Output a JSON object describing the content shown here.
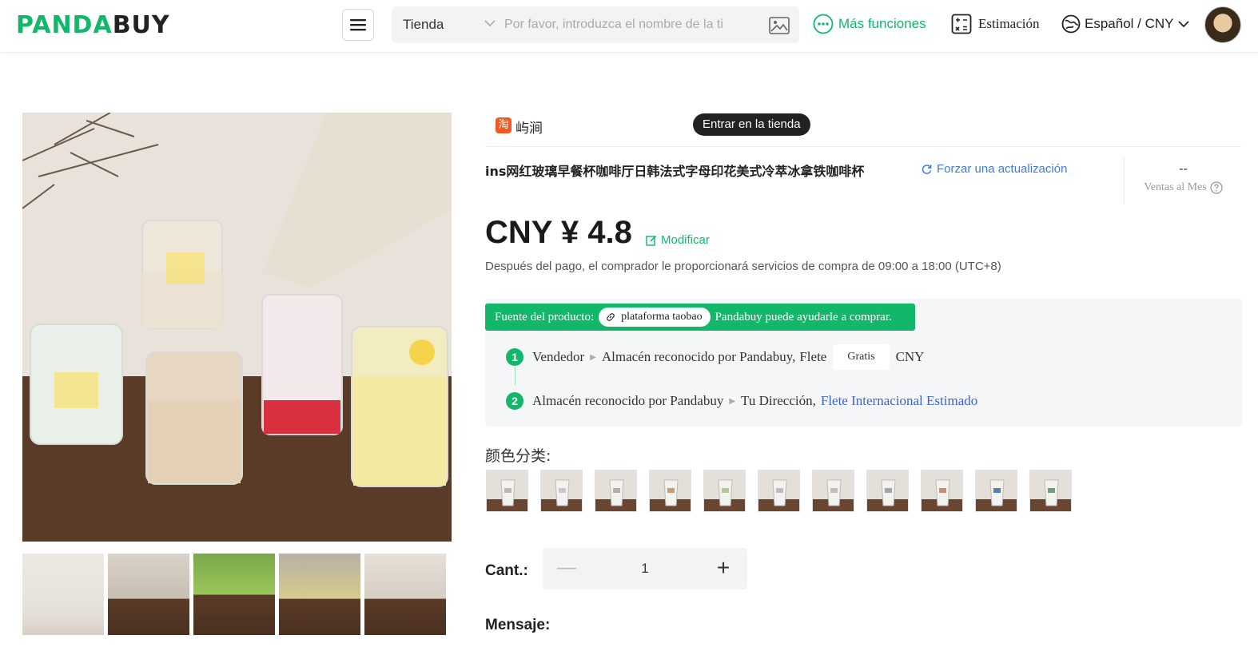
{
  "header": {
    "logo_part1": "PANDA",
    "logo_part2": "BUY",
    "search_category": "Tienda",
    "search_placeholder": "Por favor, introduzca el nombre de la ti",
    "more_functions": "Más funciones",
    "estimation": "Estimación",
    "language_currency": "Español / CNY"
  },
  "shop": {
    "name": "屿涧",
    "enter_store": "Entrar en la tienda"
  },
  "product": {
    "title": "ins网红玻璃早餐杯咖啡厅日韩法式字母印花美式冷萃冰拿铁咖啡杯",
    "force_update": "Forzar una actualización",
    "monthly_sales_value": "--",
    "monthly_sales_label": "Ventas al Mes",
    "price": "CNY ¥ 4.8",
    "modify": "Modificar",
    "purchase_note": "Después del pago, el comprador le proporcionará servicios de compra de 09:00 a 18:00 (UTC+8)"
  },
  "source": {
    "label": "Fuente del producto:",
    "platform": "plataforma taobao",
    "help": "Pandabuy puede ayudarle a comprar.",
    "step1": {
      "num": "1",
      "from": "Vendedor",
      "to": "Almacén reconocido por Pandabuy,",
      "freight": "Flete",
      "freight_value": "Gratis",
      "currency": "CNY"
    },
    "step2": {
      "num": "2",
      "from": "Almacén reconocido por Pandabuy",
      "to": "Tu Dirección,",
      "link": "Flete Internacional Estimado"
    }
  },
  "color_label": "颜色分类:",
  "swatch_accents": [
    "#b9b9b9",
    "#c8c8c8",
    "#b0b0b0",
    "#c69a7a",
    "#b8c690",
    "#bdbdbd",
    "#c0c0c0",
    "#9fa7ad",
    "#c98f70",
    "#5a7ac0",
    "#6aa07a"
  ],
  "quantity": {
    "label": "Cant.:",
    "minus": "—",
    "value": "1",
    "plus": "+"
  },
  "message_label": "Mensaje:",
  "colors": {
    "brand_green": "#12b76a",
    "link_blue": "#3b62d6"
  }
}
